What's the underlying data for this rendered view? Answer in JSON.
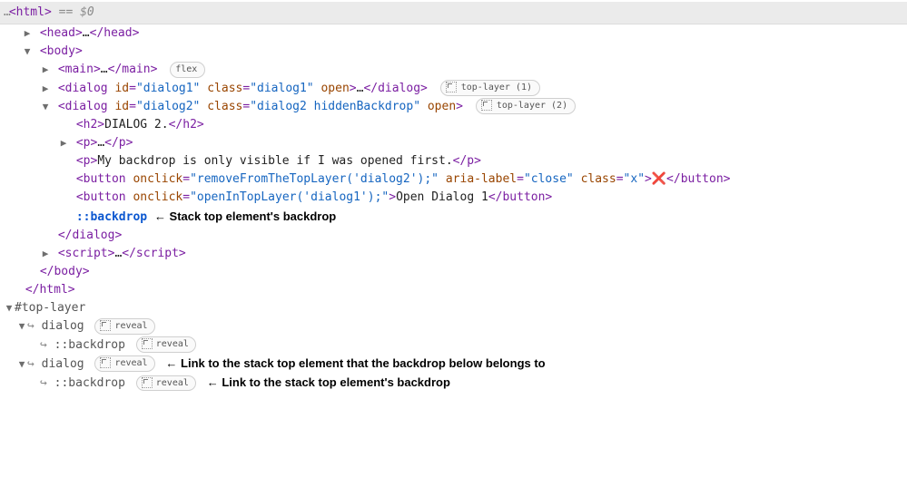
{
  "selection_marker": "== $0",
  "gutter_prefix": "…",
  "collapse_marker": "…",
  "tags": {
    "html": "html",
    "head_open": "<head>",
    "head_close": "</head>",
    "body_open": "<body>",
    "body_close": "</body>",
    "html_close": "</html>",
    "main_open": "<main>",
    "main_close": "</main>",
    "dialog_open": "<dialog",
    "dialog_close_inline": "</dialog>",
    "dialog_close_block": "</dialog>",
    "h2_open": "<h2>",
    "h2_text": "DIALOG 2.",
    "h2_close": "</h2>",
    "p_open": "<p>",
    "p_close": "</p>",
    "script_open": "<script>",
    "script_close": "</script>",
    "button_open": "<button",
    "button_close": "</button>",
    "close_angle": ">",
    "self_close": ">"
  },
  "dialog1": {
    "id_attr": "id",
    "id_val": "\"dialog1\"",
    "class_attr": "class",
    "class_val": "\"dialog1\"",
    "open_attr": "open"
  },
  "dialog2": {
    "id_attr": "id",
    "id_val": "\"dialog2\"",
    "class_attr": "class",
    "class_val": "\"dialog2 hiddenBackdrop\"",
    "open_attr": "open"
  },
  "p_text": "My backdrop is only visible if I was opened first.",
  "button_close_x": {
    "onclick_attr": "onclick",
    "onclick_val": "\"removeFromTheTopLayer('dialog2');\"",
    "aria_label_attr": "aria-label",
    "aria_label_val": "\"close\"",
    "class_attr": "class",
    "class_val": "\"x\"",
    "inner": "❌"
  },
  "button_open_d1": {
    "onclick_attr": "onclick",
    "onclick_val": "\"openInTopLayer('dialog1');\"",
    "inner": "Open Dialog 1"
  },
  "pseudo_backdrop": "::backdrop",
  "annotation_backdrop": "← Stack top element's backdrop",
  "badges": {
    "flex": "flex",
    "top1": "top-layer (1)",
    "top2": "top-layer (2)",
    "reveal": "reveal"
  },
  "toplayer": {
    "heading": "#top-layer",
    "dialog": "dialog",
    "backdrop": "::backdrop",
    "link_arrow": "↪",
    "annot_dialog": "← Link to the stack top element that the backdrop below belongs to",
    "annot_backdrop": "← Link to the stack top element's backdrop"
  },
  "indents": {
    "l0": 4,
    "l1": 24,
    "l2": 44,
    "l3": 64,
    "l4": 84,
    "tl0": 4,
    "tl1": 22,
    "tl2": 44
  }
}
